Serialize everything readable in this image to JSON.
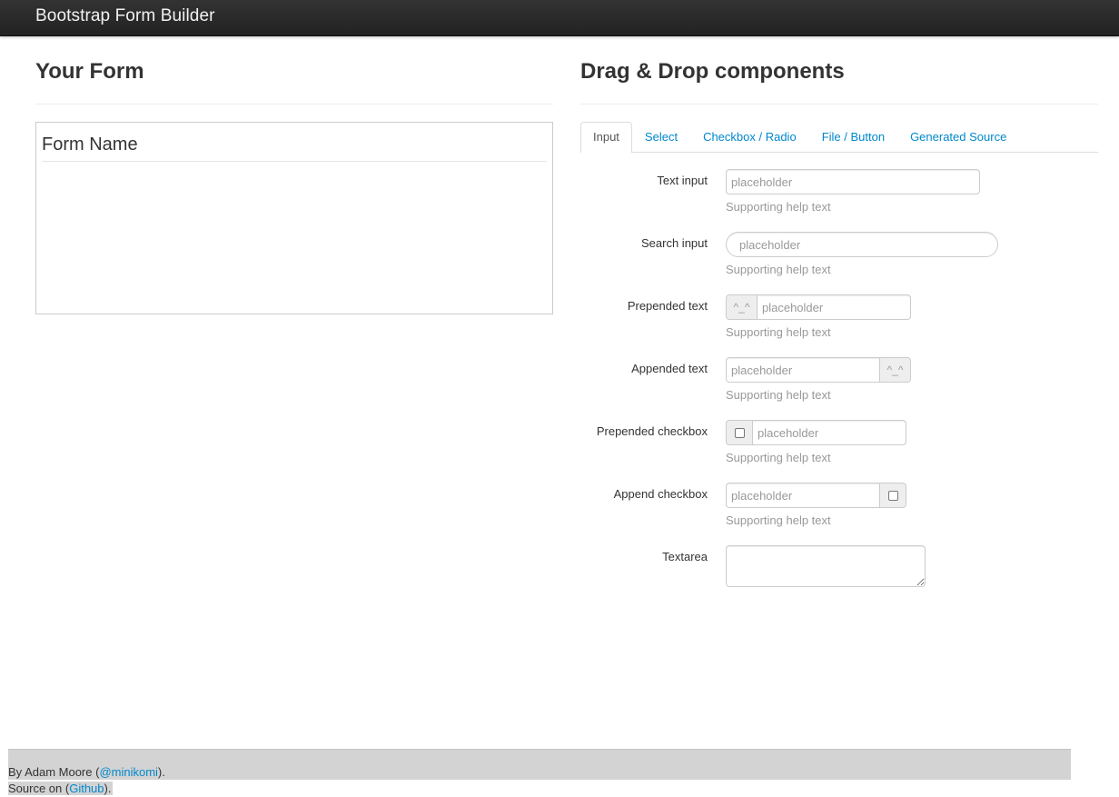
{
  "navbar": {
    "brand": "Bootstrap Form Builder"
  },
  "left": {
    "title": "Your Form",
    "form_name": "Form Name"
  },
  "right": {
    "title": "Drag & Drop components",
    "tabs": [
      {
        "label": "Input",
        "active": true
      },
      {
        "label": "Select",
        "active": false
      },
      {
        "label": "Checkbox / Radio",
        "active": false
      },
      {
        "label": "File / Button",
        "active": false
      },
      {
        "label": "Generated Source",
        "active": false
      }
    ],
    "components": {
      "text_input": {
        "label": "Text input",
        "placeholder": "placeholder",
        "help": "Supporting help text"
      },
      "search_input": {
        "label": "Search input",
        "placeholder": "placeholder",
        "help": "Supporting help text"
      },
      "prepended_text": {
        "label": "Prepended text",
        "addon": "^_^",
        "placeholder": "placeholder",
        "help": "Supporting help text"
      },
      "appended_text": {
        "label": "Appended text",
        "addon": "^_^",
        "placeholder": "placeholder",
        "help": "Supporting help text"
      },
      "prepended_checkbox": {
        "label": "Prepended checkbox",
        "placeholder": "placeholder",
        "help": "Supporting help text"
      },
      "append_checkbox": {
        "label": "Append checkbox",
        "placeholder": "placeholder",
        "help": "Supporting help text"
      },
      "textarea": {
        "label": "Textarea"
      }
    }
  },
  "footer": {
    "line1_prefix": "By Adam Moore (",
    "line1_link": "@minikomi",
    "line1_suffix": ").",
    "line2_prefix": "Source on (",
    "line2_link": "Github",
    "line2_suffix": ")."
  },
  "colors": {
    "link": "#0088cc",
    "navbar": "#222222",
    "help_text": "#999999",
    "footer_bg": "#d3d3d3"
  }
}
